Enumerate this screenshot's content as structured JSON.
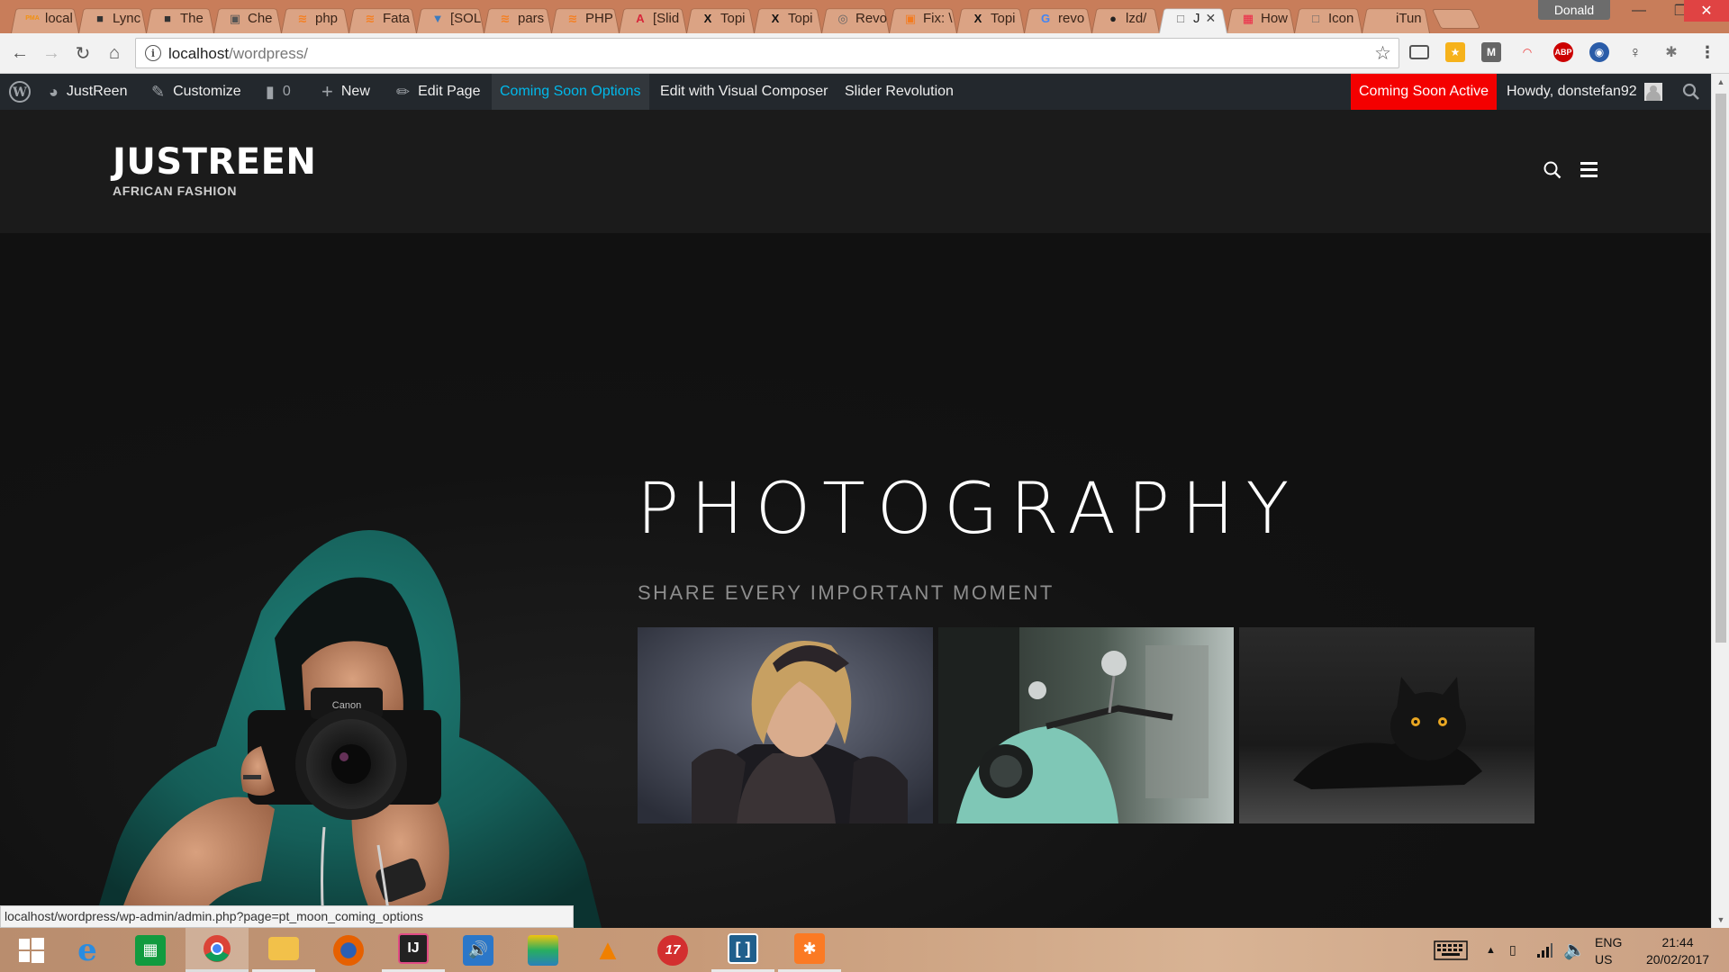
{
  "browser": {
    "tabs": [
      {
        "label": "local",
        "fav": "PMA",
        "color": "#f29111"
      },
      {
        "label": "Lync",
        "fav": "■",
        "color": "#333"
      },
      {
        "label": "The",
        "fav": "■",
        "color": "#333"
      },
      {
        "label": "Che",
        "fav": "▣",
        "color": "#555"
      },
      {
        "label": "php",
        "fav": "≋",
        "color": "#f48024"
      },
      {
        "label": "Fata",
        "fav": "≋",
        "color": "#f48024"
      },
      {
        "label": "[SOL",
        "fav": "▼",
        "color": "#3b7bbf"
      },
      {
        "label": "pars",
        "fav": "≋",
        "color": "#f48024"
      },
      {
        "label": "PHP",
        "fav": "≋",
        "color": "#f48024"
      },
      {
        "label": "[Slid",
        "fav": "A",
        "color": "#d8263a"
      },
      {
        "label": "Topi",
        "fav": "X",
        "color": "#111"
      },
      {
        "label": "Topi",
        "fav": "X",
        "color": "#111"
      },
      {
        "label": "Revo",
        "fav": "◎",
        "color": "#666"
      },
      {
        "label": "Fix: \\",
        "fav": "▣",
        "color": "#f37b20"
      },
      {
        "label": "Topi",
        "fav": "X",
        "color": "#111"
      },
      {
        "label": "revo",
        "fav": "G",
        "color": "#4285f4"
      },
      {
        "label": "lzd/",
        "fav": "●",
        "color": "#222"
      },
      {
        "label": "J",
        "fav": "□",
        "color": "#666",
        "active": true
      },
      {
        "label": "How",
        "fav": "▦",
        "color": "#e24"
      },
      {
        "label": "Icon",
        "fav": "□",
        "color": "#666"
      },
      {
        "label": "iTun",
        "fav": "",
        "color": "#888"
      }
    ],
    "profile_name": "Donald",
    "url_host": "localhost",
    "url_path": "/wordpress/"
  },
  "adminbar": {
    "site_name": "JustReen",
    "customize": "Customize",
    "comments_count": "0",
    "new_label": "New",
    "edit_page": "Edit Page",
    "coming_soon_options": "Coming Soon Options",
    "visual_composer": "Edit with Visual Composer",
    "slider_revolution": "Slider Revolution",
    "coming_soon_active": "Coming Soon Active",
    "howdy": "Howdy, donstefan92"
  },
  "site": {
    "brand": "JUSTREEN",
    "tagline": "AFRICAN FASHION"
  },
  "hero": {
    "title": "PHOTOGRAPHY",
    "subtitle": "SHARE EVERY IMPORTANT MOMENT"
  },
  "status_url": "localhost/wordpress/wp-admin/admin.php?page=pt_moon_coming_options",
  "taskbar": {
    "lang_top": "ENG",
    "lang_bottom": "US",
    "time": "21:44",
    "date": "20/02/2017"
  },
  "colors": {
    "adminbar_bg": "#23282d",
    "adminbar_highlight": "#00b9eb",
    "coming_soon_red": "#f40000",
    "site_bg": "#1b1b1b"
  }
}
